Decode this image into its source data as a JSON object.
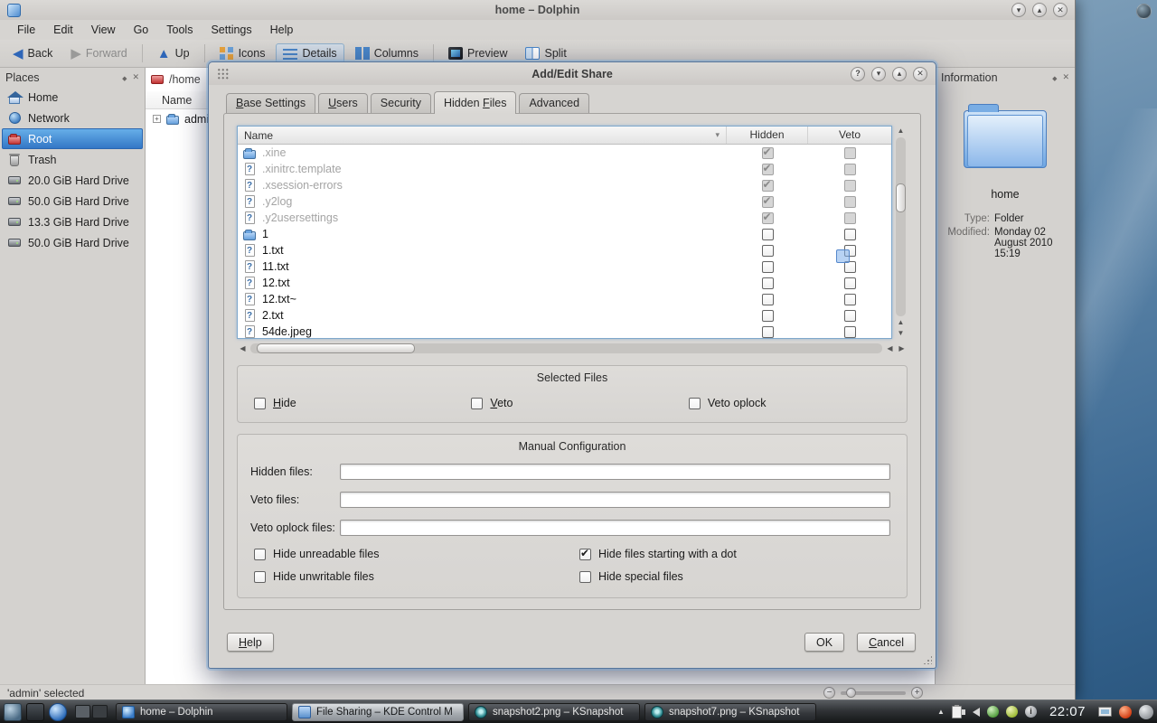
{
  "desktop": {
    "clock": "22:07"
  },
  "dolphin": {
    "title": "home – Dolphin",
    "menu_items": [
      "File",
      "Edit",
      "View",
      "Go",
      "Tools",
      "Settings",
      "Help"
    ],
    "toolbar": {
      "back": "Back",
      "forward": "Forward",
      "up": "Up",
      "icons": "Icons",
      "details": "Details",
      "columns": "Columns",
      "preview": "Preview",
      "split": "Split"
    },
    "places": {
      "title": "Places",
      "items": [
        {
          "label": "Home",
          "icon": "home-icon",
          "selected": false
        },
        {
          "label": "Network",
          "icon": "network-icon",
          "selected": false
        },
        {
          "label": "Root",
          "icon": "root-icon",
          "selected": true
        },
        {
          "label": "Trash",
          "icon": "trash-icon",
          "selected": false
        },
        {
          "label": "20.0 GiB Hard Drive",
          "icon": "drive-icon",
          "selected": false
        },
        {
          "label": "50.0 GiB Hard Drive",
          "icon": "drive-icon",
          "selected": false
        },
        {
          "label": "13.3 GiB Hard Drive",
          "icon": "drive-icon",
          "selected": false
        },
        {
          "label": "50.0 GiB Hard Drive",
          "icon": "drive-icon",
          "selected": false
        }
      ]
    },
    "location": "/home",
    "view": {
      "name_header": "Name",
      "tree_item": "admin"
    },
    "info_panel": {
      "title": "Information",
      "item_name": "home",
      "details": [
        {
          "label": "Type:",
          "value": "Folder"
        },
        {
          "label": "Modified:",
          "value": "Monday 02 August 2010 15:19"
        }
      ]
    },
    "status": "'admin' selected"
  },
  "dialog": {
    "title": "Add/Edit Share",
    "tabs": [
      {
        "label": "Base Settings",
        "accel": 0,
        "active": false
      },
      {
        "label": "Users",
        "accel": 0,
        "active": false
      },
      {
        "label": "Security",
        "active": false
      },
      {
        "label": "Hidden Files",
        "accel": 7,
        "active": true
      },
      {
        "label": "Advanced",
        "active": false
      }
    ],
    "file_list": {
      "columns": {
        "name": "Name",
        "hidden": "Hidden",
        "veto": "Veto"
      },
      "rows": [
        {
          "name": ".xine",
          "icon": "folder-icon",
          "hidden": true,
          "veto": false,
          "disabled": true
        },
        {
          "name": ".xinitrc.template",
          "icon": "unknown-icon",
          "hidden": true,
          "veto": false,
          "disabled": true
        },
        {
          "name": ".xsession-errors",
          "icon": "unknown-icon",
          "hidden": true,
          "veto": false,
          "disabled": true
        },
        {
          "name": ".y2log",
          "icon": "unknown-icon",
          "hidden": true,
          "veto": false,
          "disabled": true
        },
        {
          "name": ".y2usersettings",
          "icon": "unknown-icon",
          "hidden": true,
          "veto": false,
          "disabled": true
        },
        {
          "name": "1",
          "icon": "folder-icon",
          "hidden": false,
          "veto": false,
          "disabled": false
        },
        {
          "name": "1.txt",
          "icon": "unknown-icon",
          "hidden": false,
          "veto": false,
          "disabled": false
        },
        {
          "name": "11.txt",
          "icon": "unknown-icon",
          "hidden": false,
          "veto": false,
          "disabled": false
        },
        {
          "name": "12.txt",
          "icon": "unknown-icon",
          "hidden": false,
          "veto": false,
          "disabled": false
        },
        {
          "name": "12.txt~",
          "icon": "unknown-icon",
          "hidden": false,
          "veto": false,
          "disabled": false
        },
        {
          "name": "2.txt",
          "icon": "unknown-icon",
          "hidden": false,
          "veto": false,
          "disabled": false
        },
        {
          "name": "54de.jpeg",
          "icon": "unknown-icon",
          "hidden": false,
          "veto": false,
          "disabled": false
        }
      ]
    },
    "selected_files": {
      "title": "Selected Files",
      "checkboxes": [
        {
          "label": "Hide",
          "accel": 0,
          "checked": false
        },
        {
          "label": "Veto",
          "accel": 0,
          "checked": false
        },
        {
          "label": "Veto oplock",
          "checked": false
        }
      ]
    },
    "manual_config": {
      "title": "Manual Configuration",
      "fields": [
        {
          "label": "Hidden files:",
          "value": ""
        },
        {
          "label": "Veto files:",
          "value": ""
        },
        {
          "label": "Veto oplock files:",
          "value": ""
        }
      ],
      "checkboxes": [
        {
          "label": "Hide unreadable files",
          "checked": false
        },
        {
          "label": "Hide files starting with a dot",
          "checked": true
        },
        {
          "label": "Hide unwritable files",
          "checked": false
        },
        {
          "label": "Hide special files",
          "checked": false
        }
      ]
    },
    "buttons": {
      "help": {
        "label": "Help",
        "accel": 0
      },
      "ok": {
        "label": "OK"
      },
      "cancel": {
        "label": "Cancel",
        "accel": 0
      }
    }
  },
  "taskbar": {
    "tasks": [
      {
        "label": "home – Dolphin",
        "icon": "dolphin-task-icon",
        "active": false
      },
      {
        "label": "File Sharing – KDE Control M",
        "icon": "filesharing-task-icon",
        "active": true
      },
      {
        "label": "snapshot2.png – KSnapshot",
        "icon": "ksnapshot-task-icon",
        "active": false
      },
      {
        "label": "snapshot7.png – KSnapshot",
        "icon": "ksnapshot-task-icon",
        "active": false
      }
    ],
    "clock": "22:07"
  }
}
